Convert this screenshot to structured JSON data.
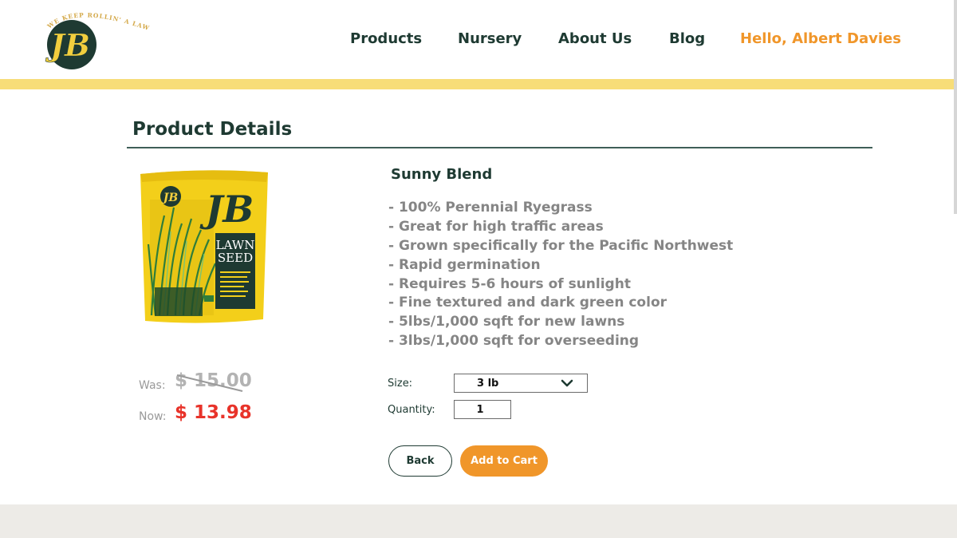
{
  "brand": {
    "tagline": "WE KEEP ROLLIN' A LAWN",
    "monogram": "JB"
  },
  "nav": {
    "products": "Products",
    "nursery": "Nursery",
    "about": "About Us",
    "blog": "Blog",
    "user_greeting": "Hello, Albert Davies"
  },
  "page": {
    "title": "Product Details"
  },
  "product": {
    "name": "Sunny Blend",
    "package_text": [
      "JB",
      "LAWN",
      "SEED"
    ],
    "features": [
      "- 100% Perennial Ryegrass",
      "- Great for high traffic areas",
      "- Grown specifically for the Pacific Northwest",
      "- Rapid germination",
      "- Requires 5-6 hours of sunlight",
      "- Fine textured and dark green color",
      "- 5lbs/1,000 sqft for new lawns",
      "- 3lbs/1,000 sqft for overseeding"
    ],
    "was_label": "Was:",
    "was_price": "$ 15.00",
    "now_label": "Now:",
    "now_price": "$ 13.98"
  },
  "form": {
    "size_label": "Size:",
    "size_value": "3 lb",
    "quantity_label": "Quantity:",
    "quantity_value": "1",
    "back_label": "Back",
    "add_to_cart_label": "Add to Cart"
  },
  "colors": {
    "brand_green": "#1e3a32",
    "accent_orange": "#f0962a",
    "header_band_yellow": "#f7dd78",
    "sale_red": "#e8332a",
    "footer_gray": "#edebe7"
  }
}
